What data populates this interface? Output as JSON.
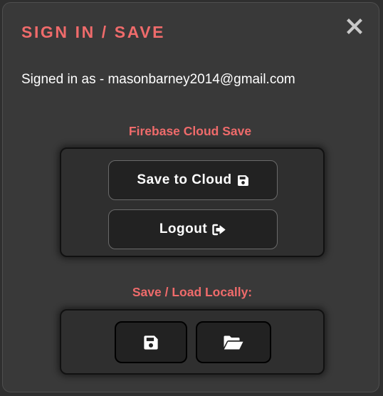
{
  "dialog": {
    "title": "SIGN IN / SAVE",
    "close_icon": "close-icon",
    "signed_in_text": "Signed in as - masonbarney2014@gmail.com"
  },
  "cloud": {
    "heading": "Firebase Cloud Save",
    "save_label": "Save to Cloud",
    "save_icon": "floppy-disk-icon",
    "logout_label": "Logout",
    "logout_icon": "sign-out-icon"
  },
  "local": {
    "heading": "Save / Load Locally:",
    "save_icon": "floppy-disk-icon",
    "load_icon": "open-folder-icon"
  },
  "colors": {
    "accent": "#ef6b6b",
    "dialog_background": "#393939",
    "panel_background": "#2f2f2f",
    "button_background": "#222222",
    "text": "#ffffff"
  }
}
